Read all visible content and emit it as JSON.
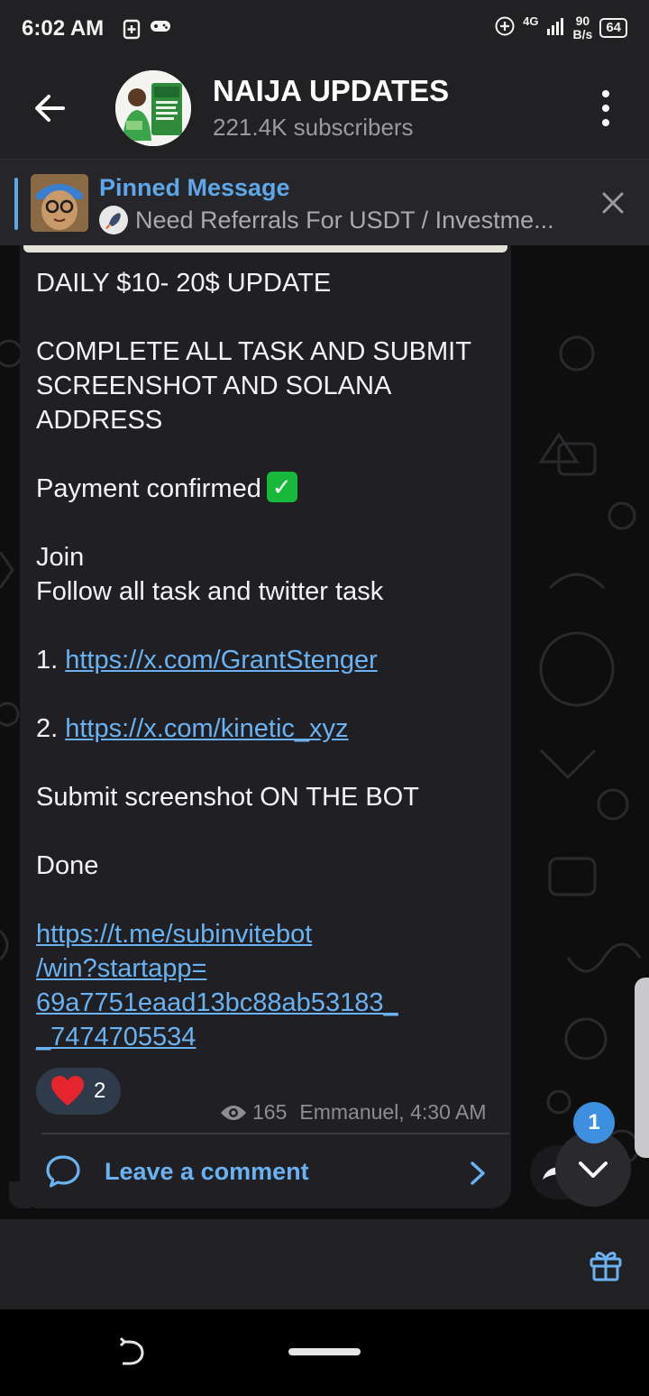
{
  "status_bar": {
    "time": "6:02 AM",
    "network": "4G",
    "speed_value": "90",
    "speed_unit": "B/s",
    "battery": "64"
  },
  "header": {
    "title": "NAIJA UPDATES",
    "subscribers": "221.4K subscribers"
  },
  "pinned": {
    "title": "Pinned Message",
    "text": "Need Referrals For USDT / Investme..."
  },
  "message": {
    "line1": "DAILY $10- 20$ UPDATE",
    "line2": "COMPLETE ALL TASK AND SUBMIT",
    "line3": "SCREENSHOT AND SOLANA",
    "line4": "ADDRESS",
    "line5": "Payment confirmed",
    "line6": "Join",
    "line7": "Follow all task and twitter task",
    "item1_prefix": "1. ",
    "item1_link": "https://x.com/GrantStenger",
    "item2_prefix": "2. ",
    "item2_link": "https://x.com/kinetic_xyz",
    "line8": "Submit screenshot ON THE BOT",
    "line9": "Done",
    "bot_link_1": "https://t.me/subinvitebot",
    "bot_link_2": "/win?startapp=",
    "bot_link_3": "69a7751eaad13bc88ab53183_",
    "bot_link_4": "_7474705534"
  },
  "reaction": {
    "count": "2"
  },
  "meta": {
    "views": "165",
    "author_time": "Emmanuel, 4:30 AM"
  },
  "comment": {
    "label": "Leave a comment"
  },
  "scroll": {
    "badge": "1"
  },
  "colors": {
    "accent": "#6ab2f2",
    "pinned_accent": "#5ea7e8",
    "bubble": "#202024",
    "check": "#18b83b"
  }
}
